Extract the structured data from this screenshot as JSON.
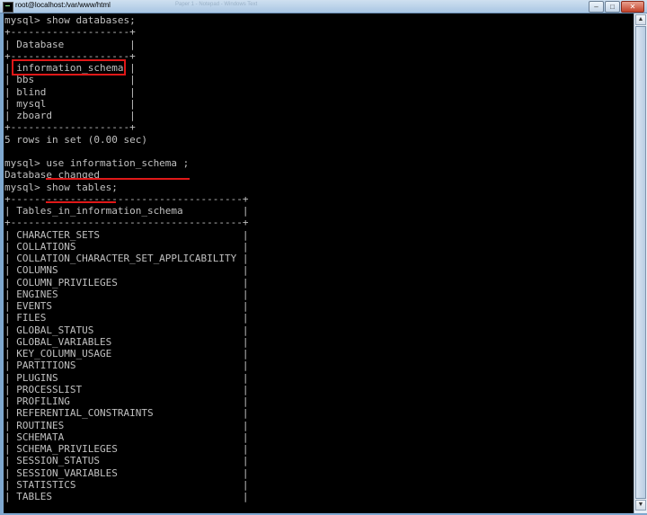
{
  "window": {
    "title": "root@localhost:/var/www/html",
    "background_title": "Paper 1 - Notepad - Windows Text",
    "controls": {
      "minimize": "–",
      "maximize": "□",
      "close": "✕"
    }
  },
  "terminal": {
    "lines": [
      "mysql> show databases;",
      "+--------------------+",
      "| Database           |",
      "+--------------------+",
      "| information_schema |",
      "| bbs                |",
      "| blind              |",
      "| mysql              |",
      "| zboard             |",
      "+--------------------+",
      "5 rows in set (0.00 sec)",
      "",
      "mysql> use information_schema ;",
      "Database changed",
      "mysql> show tables;",
      "+---------------------------------------+",
      "| Tables_in_information_schema          |",
      "+---------------------------------------+",
      "| CHARACTER_SETS                        |",
      "| COLLATIONS                            |",
      "| COLLATION_CHARACTER_SET_APPLICABILITY |",
      "| COLUMNS                               |",
      "| COLUMN_PRIVILEGES                     |",
      "| ENGINES                               |",
      "| EVENTS                                |",
      "| FILES                                 |",
      "| GLOBAL_STATUS                         |",
      "| GLOBAL_VARIABLES                      |",
      "| KEY_COLUMN_USAGE                      |",
      "| PARTITIONS                            |",
      "| PLUGINS                               |",
      "| PROCESSLIST                           |",
      "| PROFILING                             |",
      "| REFERENTIAL_CONSTRAINTS               |",
      "| ROUTINES                              |",
      "| SCHEMATA                              |",
      "| SCHEMA_PRIVILEGES                     |",
      "| SESSION_STATUS                        |",
      "| SESSION_VARIABLES                     |",
      "| STATISTICS                            |",
      "| TABLES                                |"
    ],
    "highlight_color": "#e01818",
    "text_color": "#c0c0c0",
    "background_color": "#000000"
  },
  "scrollbar": {
    "up_arrow": "▲",
    "down_arrow": "▼"
  }
}
